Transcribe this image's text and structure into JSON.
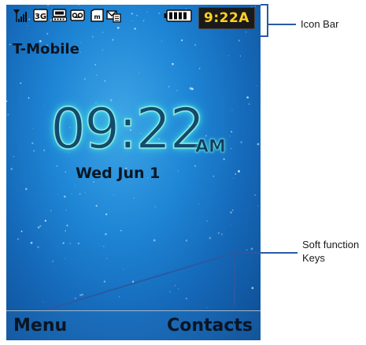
{
  "status_bar": {
    "icons": [
      "signal-strength-icon",
      "3g-icon",
      "tty-icon",
      "voicemail-icon",
      "memory-card-icon",
      "new-message-icon",
      "battery-icon"
    ],
    "time": "9:22A"
  },
  "carrier": "T-Mobile",
  "clock": {
    "time": "09:22",
    "ampm": "AM",
    "date": "Wed Jun 1"
  },
  "softkeys": {
    "left": "Menu",
    "right": "Contacts"
  },
  "callouts": {
    "icon_bar": "Icon Bar",
    "soft_function_keys": [
      "Soft function",
      "Keys"
    ]
  },
  "colors": {
    "wallpaper_center": "#3fa6e6",
    "wallpaper_edge": "#0d4c92",
    "clock_glow": "#47e0e6",
    "status_time": "#ffd21f",
    "callout_line": "#2a5aa3"
  }
}
